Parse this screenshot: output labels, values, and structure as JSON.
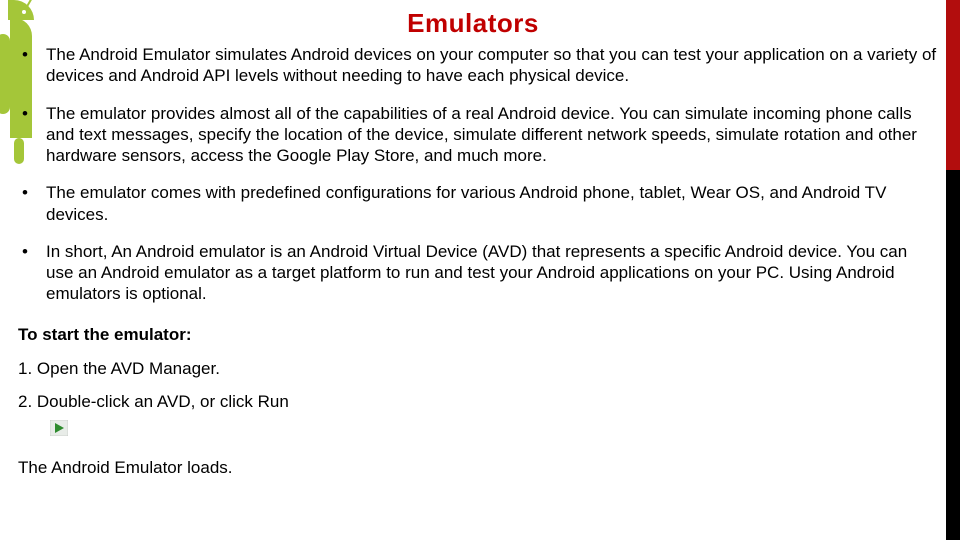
{
  "title": "Emulators",
  "bullets": [
    "The Android Emulator simulates Android devices on your computer so that you can test your application on a variety of devices and Android API levels without needing to have each physical device.",
    "The emulator provides almost all of the capabilities of a real Android device. You can simulate incoming phone calls and text messages, specify the location of the device, simulate different network speeds, simulate rotation and other hardware sensors, access the Google Play Store, and much more.",
    "The emulator comes with predefined configurations for various Android phone, tablet, Wear OS, and Android TV devices.",
    "In short, An Android emulator is an Android Virtual Device (AVD) that represents a specific Android device. You can use an Android emulator as a target platform to run and test your Android applications on your PC. Using Android emulators is optional."
  ],
  "subhead": "To start the emulator:",
  "steps": [
    "1. Open the AVD Manager.",
    "2. Double-click an AVD, or click Run"
  ],
  "closing": "The Android Emulator loads.",
  "icons": {
    "run": "run-icon",
    "android_mascot": "android-mascot"
  }
}
